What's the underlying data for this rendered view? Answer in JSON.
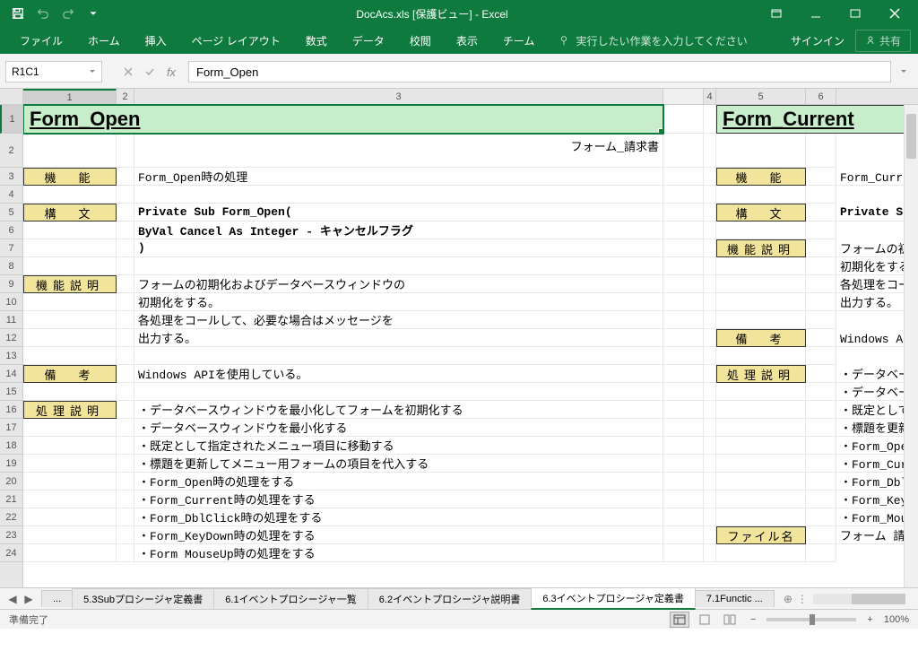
{
  "titlebar": {
    "title": "DocAcs.xls [保護ビュー] - Excel"
  },
  "ribbon": {
    "tabs": [
      "ファイル",
      "ホーム",
      "挿入",
      "ページ レイアウト",
      "数式",
      "データ",
      "校閲",
      "表示",
      "チーム"
    ],
    "tellme": "実行したい作業を入力してください",
    "signin": "サインイン",
    "share": "共有"
  },
  "formula_bar": {
    "namebox": "R1C1",
    "formula": "Form_Open"
  },
  "columns": [
    "1",
    "2",
    "3",
    "",
    "4",
    "5",
    "6"
  ],
  "rows": [
    "1",
    "2",
    "3",
    "4",
    "5",
    "6",
    "7",
    "8",
    "9",
    "10",
    "11",
    "12",
    "13",
    "14",
    "15",
    "16",
    "17",
    "18",
    "19",
    "20",
    "21",
    "22",
    "23",
    "24"
  ],
  "left": {
    "title": "Form_Open",
    "subtitle": "フォーム_請求書",
    "labels": {
      "kinou": "機　能",
      "koubun": "構　文",
      "setsumei": "機能説明",
      "bikou": "備　考",
      "shori": "処理説明"
    },
    "kinou_text": "Form_Open時の処理",
    "koubun_lines": [
      "Private Sub Form_Open(",
      "  ByVal Cancel  As Integer - キャンセルフラグ",
      ")"
    ],
    "setsumei_lines": [
      "フォームの初期化およびデータベースウィンドウの",
      "初期化をする。",
      "各処理をコールして、必要な場合はメッセージを",
      "出力する。"
    ],
    "bikou_text": "Windows APIを使用している。",
    "shori_lines": [
      "・データベースウィンドウを最小化してフォームを初期化する",
      "・データベースウィンドウを最小化する",
      "・既定として指定されたメニュー項目に移動する",
      "・標題を更新してメニュー用フォームの項目を代入する",
      "・Form_Open時の処理をする",
      "・Form_Current時の処理をする",
      "・Form_DblClick時の処理をする",
      "・Form_KeyDown時の処理をする",
      "・Form MouseUp時の処理をする"
    ]
  },
  "right": {
    "title": "Form_Current",
    "labels": {
      "kinou": "機　能",
      "koubun": "構　文",
      "setsumei": "機能説明",
      "bikou": "備　考",
      "shori": "処理説明",
      "file": "ファイル名"
    },
    "kinou_text": "Form_Current時",
    "koubun_text": "Private Sub",
    "setsumei_lines": [
      "フォームの初期",
      "初期化をする。",
      "各処理をコール",
      "出力する。"
    ],
    "bikou_text": "Windows APIを",
    "shori_lines": [
      "・データベース",
      "・データベース",
      "・既定として指",
      "・標題を更新し",
      "・Form_Open時",
      "・Form_Current",
      "・Form_DblClic",
      "・Form_KeyDown",
      "・Form_MouseUp"
    ],
    "file_text": "フォーム 請求書"
  },
  "sheet_tabs": {
    "ellipsis": "...",
    "tabs": [
      "5.3Subプロシージャ定義書",
      "6.1イベントプロシージャ一覧",
      "6.2イベントプロシージャ説明書",
      "6.3イベントプロシージャ定義書",
      "7.1Functic ..."
    ],
    "active_index": 3
  },
  "statusbar": {
    "status": "準備完了",
    "zoom": "100%"
  }
}
